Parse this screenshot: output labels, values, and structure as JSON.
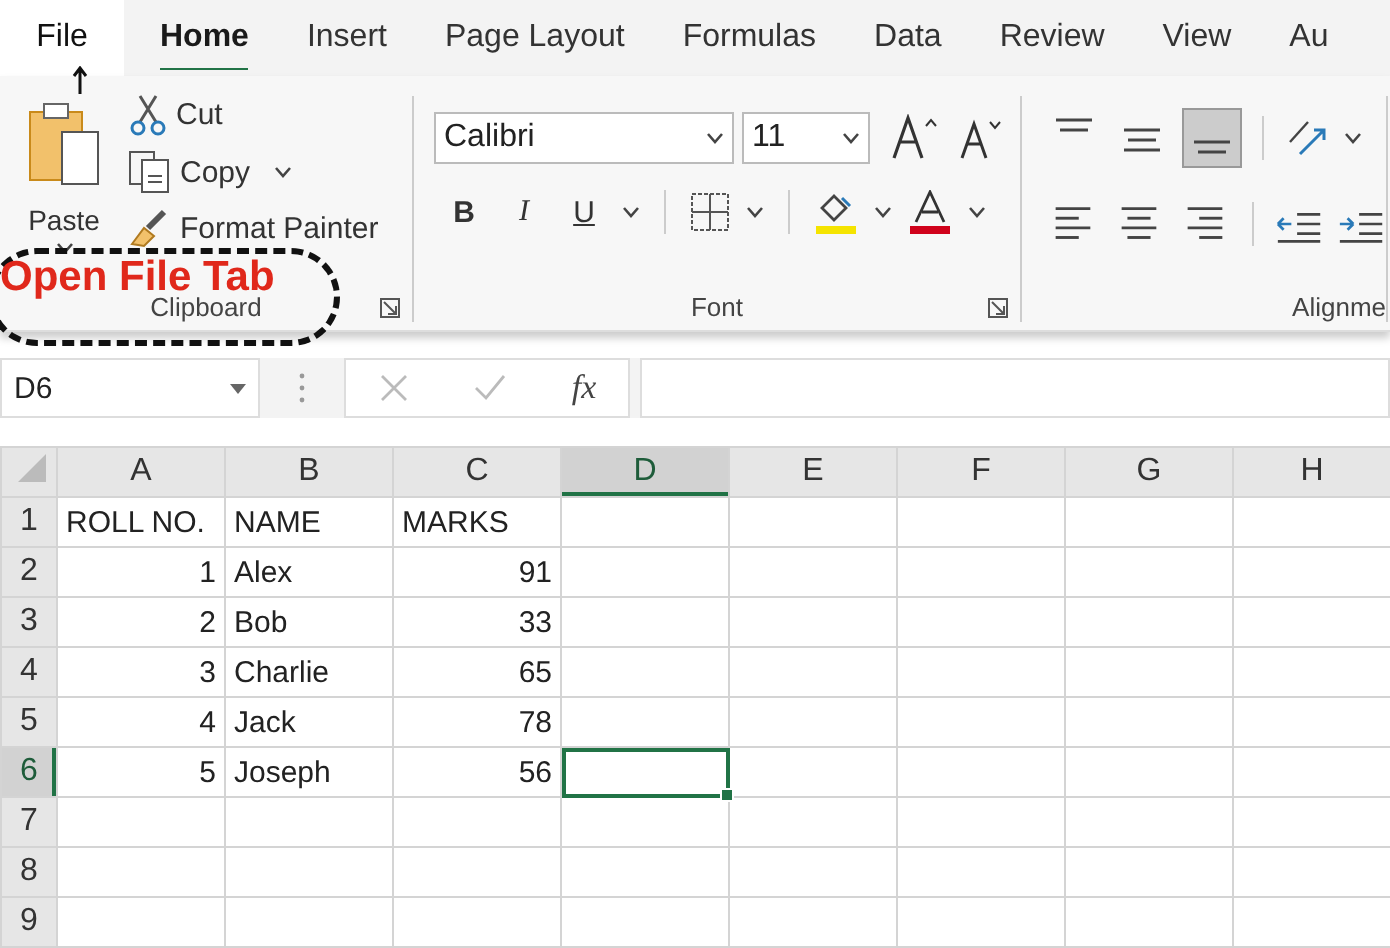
{
  "ribbon_tabs": [
    {
      "label": "File",
      "selected": false
    },
    {
      "label": "Home",
      "selected": true
    },
    {
      "label": "Insert",
      "selected": false
    },
    {
      "label": "Page Layout",
      "selected": false
    },
    {
      "label": "Formulas",
      "selected": false
    },
    {
      "label": "Data",
      "selected": false
    },
    {
      "label": "Review",
      "selected": false
    },
    {
      "label": "View",
      "selected": false
    },
    {
      "label": "Au",
      "selected": false
    }
  ],
  "clipboard": {
    "paste": "Paste",
    "cut": "Cut",
    "copy": "Copy",
    "format_painter": "Format Painter",
    "label": "Clipboard"
  },
  "font": {
    "font_name": "Calibri",
    "font_size": "11",
    "bold": "B",
    "italic": "I",
    "underline": "U",
    "label": "Font"
  },
  "alignment": {
    "label": "Alignme"
  },
  "formula_bar": {
    "name_box": "D6",
    "function_label": "fx"
  },
  "sheet": {
    "columns": [
      {
        "label": "A",
        "selected": false
      },
      {
        "label": "B",
        "selected": false
      },
      {
        "label": "C",
        "selected": false
      },
      {
        "label": "D",
        "selected": true
      },
      {
        "label": "E",
        "selected": false
      },
      {
        "label": "F",
        "selected": false
      },
      {
        "label": "G",
        "selected": false
      },
      {
        "label": "H",
        "selected": false
      }
    ],
    "rows": [
      {
        "number": "1",
        "selected": false,
        "cells": [
          {
            "text": "ROLL NO.",
            "kind": "text"
          },
          {
            "text": "NAME",
            "kind": "text"
          },
          {
            "text": "MARKS",
            "kind": "text"
          }
        ]
      },
      {
        "number": "2",
        "selected": false,
        "cells": [
          {
            "text": "1",
            "kind": "number"
          },
          {
            "text": "Alex",
            "kind": "text"
          },
          {
            "text": "91",
            "kind": "number"
          }
        ]
      },
      {
        "number": "3",
        "selected": false,
        "cells": [
          {
            "text": "2",
            "kind": "number"
          },
          {
            "text": "Bob",
            "kind": "text"
          },
          {
            "text": "33",
            "kind": "number"
          }
        ]
      },
      {
        "number": "4",
        "selected": false,
        "cells": [
          {
            "text": "3",
            "kind": "number"
          },
          {
            "text": "Charlie",
            "kind": "text"
          },
          {
            "text": "65",
            "kind": "number"
          }
        ]
      },
      {
        "number": "5",
        "selected": false,
        "cells": [
          {
            "text": "4",
            "kind": "number"
          },
          {
            "text": "Jack",
            "kind": "text"
          },
          {
            "text": "78",
            "kind": "number"
          }
        ]
      },
      {
        "number": "6",
        "selected": true,
        "cells": [
          {
            "text": "5",
            "kind": "number"
          },
          {
            "text": "Joseph",
            "kind": "text"
          },
          {
            "text": "56",
            "kind": "number"
          }
        ]
      },
      {
        "number": "7",
        "selected": false,
        "cells": []
      },
      {
        "number": "8",
        "selected": false,
        "cells": []
      },
      {
        "number": "9",
        "selected": false,
        "cells": []
      }
    ]
  },
  "annotation": {
    "text": "Open File Tab"
  }
}
